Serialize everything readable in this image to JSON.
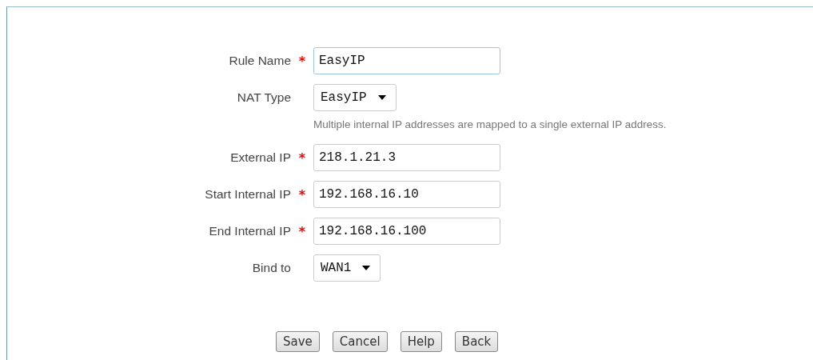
{
  "form": {
    "rows": [
      {
        "kind": "text",
        "label": "Rule Name",
        "required_mark": "*",
        "value": "EasyIP",
        "focused": true
      },
      {
        "kind": "select",
        "label": "NAT Type",
        "value": "EasyIP",
        "hint": "Multiple internal IP addresses are mapped to a single external IP address."
      },
      {
        "kind": "text",
        "label": "External IP",
        "required_mark": "*",
        "value": "218.1.21.3",
        "focused": false
      },
      {
        "kind": "text",
        "label": "Start Internal IP",
        "required_mark": "*",
        "value": "192.168.16.10",
        "focused": false
      },
      {
        "kind": "text",
        "label": "End Internal IP",
        "required_mark": "*",
        "value": "192.168.16.100",
        "focused": false
      },
      {
        "kind": "select",
        "label": "Bind to",
        "value": "WAN1"
      }
    ]
  },
  "buttons": [
    "Save",
    "Cancel",
    "Help",
    "Back"
  ]
}
